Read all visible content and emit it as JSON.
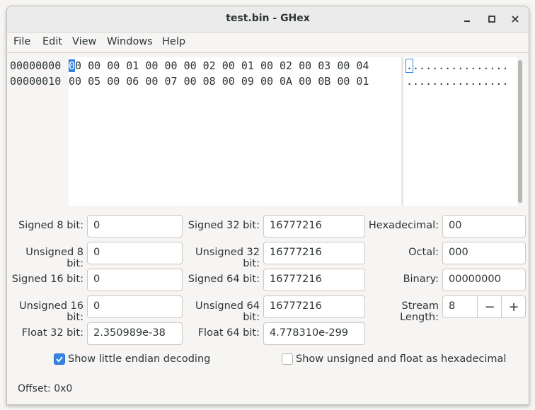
{
  "window": {
    "title": "test.bin - GHex"
  },
  "menu": [
    "File",
    "Edit",
    "View",
    "Windows",
    "Help"
  ],
  "hex": {
    "offsets": [
      "00000000",
      "00000010"
    ],
    "rows": [
      {
        "bytes": [
          "00",
          "00",
          "00",
          "01",
          "00",
          "00",
          "00",
          "02",
          "00",
          "01",
          "00",
          "02",
          "00",
          "03",
          "00",
          "04"
        ],
        "ascii": "................"
      },
      {
        "bytes": [
          "00",
          "05",
          "00",
          "06",
          "00",
          "07",
          "00",
          "08",
          "00",
          "09",
          "00",
          "0A",
          "00",
          "0B",
          "00",
          "01"
        ],
        "ascii": "................"
      }
    ]
  },
  "fields": {
    "signed8": {
      "label": "Signed 8 bit:",
      "value": "0"
    },
    "unsigned8": {
      "label": "Unsigned 8 bit:",
      "value": "0"
    },
    "signed16": {
      "label": "Signed 16 bit:",
      "value": "0"
    },
    "unsigned16": {
      "label": "Unsigned 16 bit:",
      "value": "0"
    },
    "float32": {
      "label": "Float 32 bit:",
      "value": "2.350989e-38"
    },
    "signed32": {
      "label": "Signed 32 bit:",
      "value": "16777216"
    },
    "unsigned32": {
      "label": "Unsigned 32 bit:",
      "value": "16777216"
    },
    "signed64": {
      "label": "Signed 64 bit:",
      "value": "16777216"
    },
    "unsigned64": {
      "label": "Unsigned 64 bit:",
      "value": "16777216"
    },
    "float64": {
      "label": "Float 64 bit:",
      "value": "4.778310e-299"
    },
    "hexadecimal": {
      "label": "Hexadecimal:",
      "value": "00"
    },
    "octal": {
      "label": "Octal:",
      "value": "000"
    },
    "binary": {
      "label": "Binary:",
      "value": "00000000"
    },
    "stream_length": {
      "label": "Stream Length:",
      "value": "8",
      "minus": "−",
      "plus": "+"
    }
  },
  "options": {
    "little_endian": {
      "label": "Show little endian decoding",
      "checked": true
    },
    "unsigned_hex": {
      "label": "Show unsigned and float as hexadecimal",
      "checked": false
    }
  },
  "status": {
    "offset": "Offset: 0x0"
  },
  "colors": {
    "accent": "#3584e4"
  },
  "icons": [
    "minimize-icon",
    "maximize-icon",
    "close-icon",
    "checkmark-icon"
  ]
}
